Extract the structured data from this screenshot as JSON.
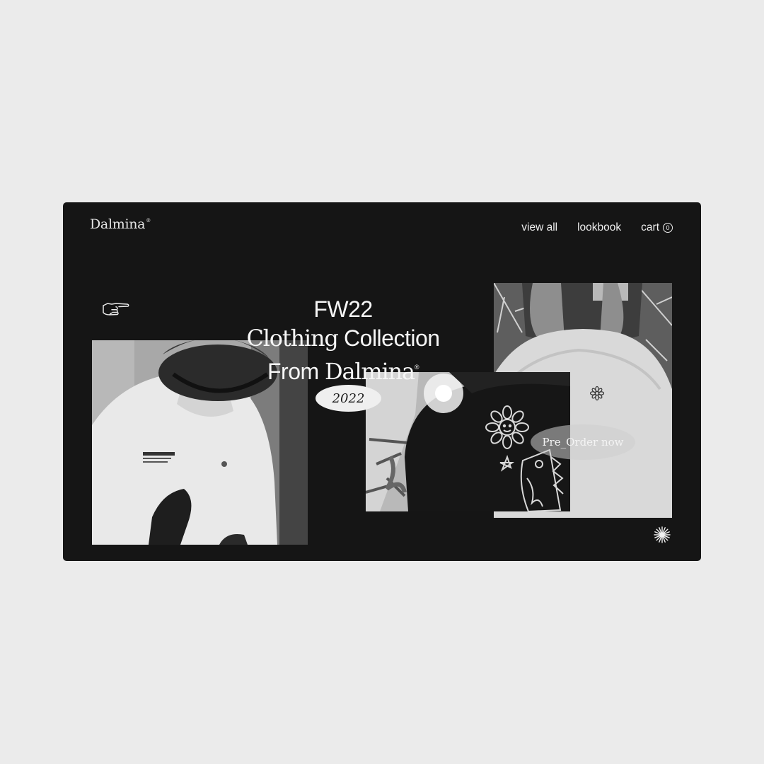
{
  "brand": {
    "name": "Dalmina",
    "mark": "®"
  },
  "nav": {
    "view_all": "view all",
    "lookbook": "lookbook",
    "cart": "cart",
    "cart_count": "0"
  },
  "hero": {
    "line1": "FW22",
    "line2_serif": "Clothing",
    "line2_sans": "Collection",
    "line3_sans": "From",
    "line3_serif": "Dalmina",
    "line3_mark": "®",
    "year": "2022"
  },
  "cta": {
    "preorder": "Pre_Order now"
  },
  "icons": {
    "pointer": "pointing-hand-icon",
    "burst": "sparkle-burst-icon",
    "flower": "flower-icon"
  },
  "colors": {
    "background": "#ebebeb",
    "panel": "#151515",
    "text": "#f6f6f6"
  }
}
